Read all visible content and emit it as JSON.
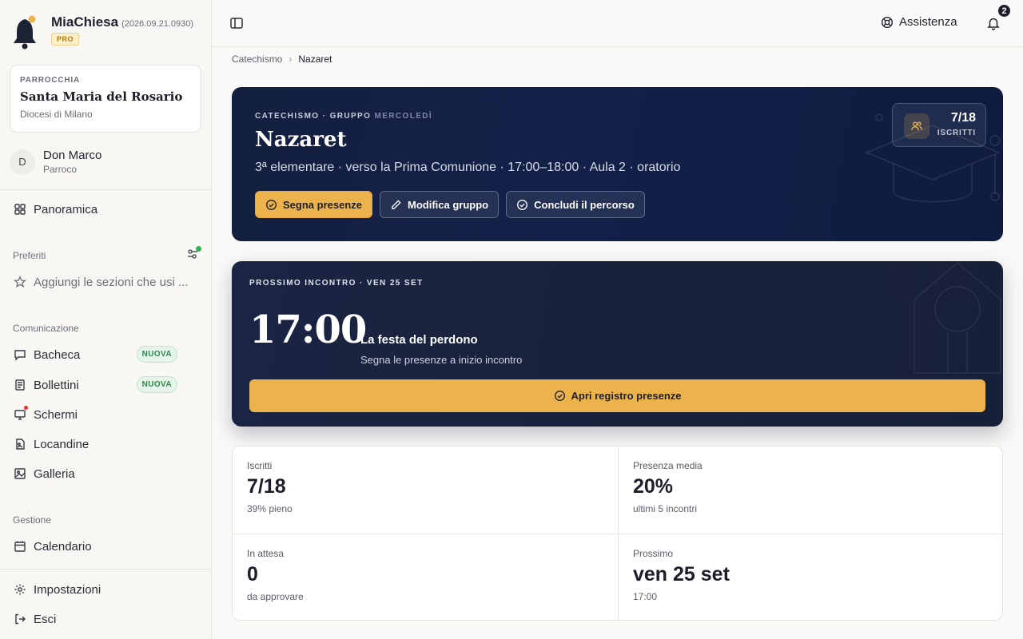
{
  "brand": {
    "name": "MiaChiesa",
    "version": "(2026.09.21.0930)",
    "plan": "PRO"
  },
  "parish": {
    "eyebrow": "PARROCCHIA",
    "name": "Santa Maria del Rosario",
    "diocese": "Diocesi di Milano"
  },
  "user": {
    "initial": "D",
    "name": "Don Marco",
    "role": "Parroco"
  },
  "sidebar": {
    "overview": "Panoramica",
    "favorites": {
      "label": "Preferiti",
      "placeholder": "Aggiungi le sezioni che usi ..."
    },
    "communication": {
      "label": "Comunicazione",
      "items": [
        {
          "label": "Bacheca",
          "badge": "NUOVA",
          "icon": "message-icon"
        },
        {
          "label": "Bollettini",
          "badge": "NUOVA",
          "icon": "newspaper-icon"
        },
        {
          "label": "Schermi",
          "icon": "monitor-icon"
        },
        {
          "label": "Locandine",
          "icon": "poster-icon"
        },
        {
          "label": "Galleria",
          "icon": "gallery-icon"
        }
      ]
    },
    "management": {
      "label": "Gestione",
      "items": [
        {
          "label": "Calendario",
          "icon": "calendar-icon"
        }
      ]
    },
    "settings": "Impostazioni",
    "logout": "Esci"
  },
  "topbar": {
    "help": "Assistenza",
    "notifications": "2"
  },
  "breadcrumb": {
    "parent": "Catechismo",
    "current": "Nazaret"
  },
  "hero": {
    "eyebrow": "CATECHISMO · GRUPPO",
    "eyebrow_day": "MERCOLEDÌ",
    "title": "Nazaret",
    "subtitle": "3ª elementare · verso la Prima Comunione · 17:00–18:00 · Aula 2 · oratorio",
    "actions": {
      "attendance": "Segna presenze",
      "edit": "Modifica gruppo",
      "finish": "Concludi il percorso"
    },
    "enrolled": {
      "value": "7/18",
      "label": "ISCRITTI"
    }
  },
  "next_meeting": {
    "eyebrow": "PROSSIMO INCONTRO · VEN 25 SET",
    "time": "17:00",
    "title": "La festa del perdono",
    "subtitle": "Segna le presenze a inizio incontro",
    "button": "Apri registro presenze"
  },
  "stats": [
    {
      "label": "Iscritti",
      "value": "7/18",
      "note": "39% pieno"
    },
    {
      "label": "Presenza media",
      "value": "20%",
      "note": "ultimi 5 incontri"
    },
    {
      "label": "In attesa",
      "value": "0",
      "note": "da approvare"
    },
    {
      "label": "Prossimo",
      "value": "ven 25 set",
      "note": "17:00"
    }
  ],
  "colors": {
    "accent": "#ecb34d",
    "navy": "#13214a",
    "success": "#2b8a4b",
    "alert": "#e0322f"
  }
}
